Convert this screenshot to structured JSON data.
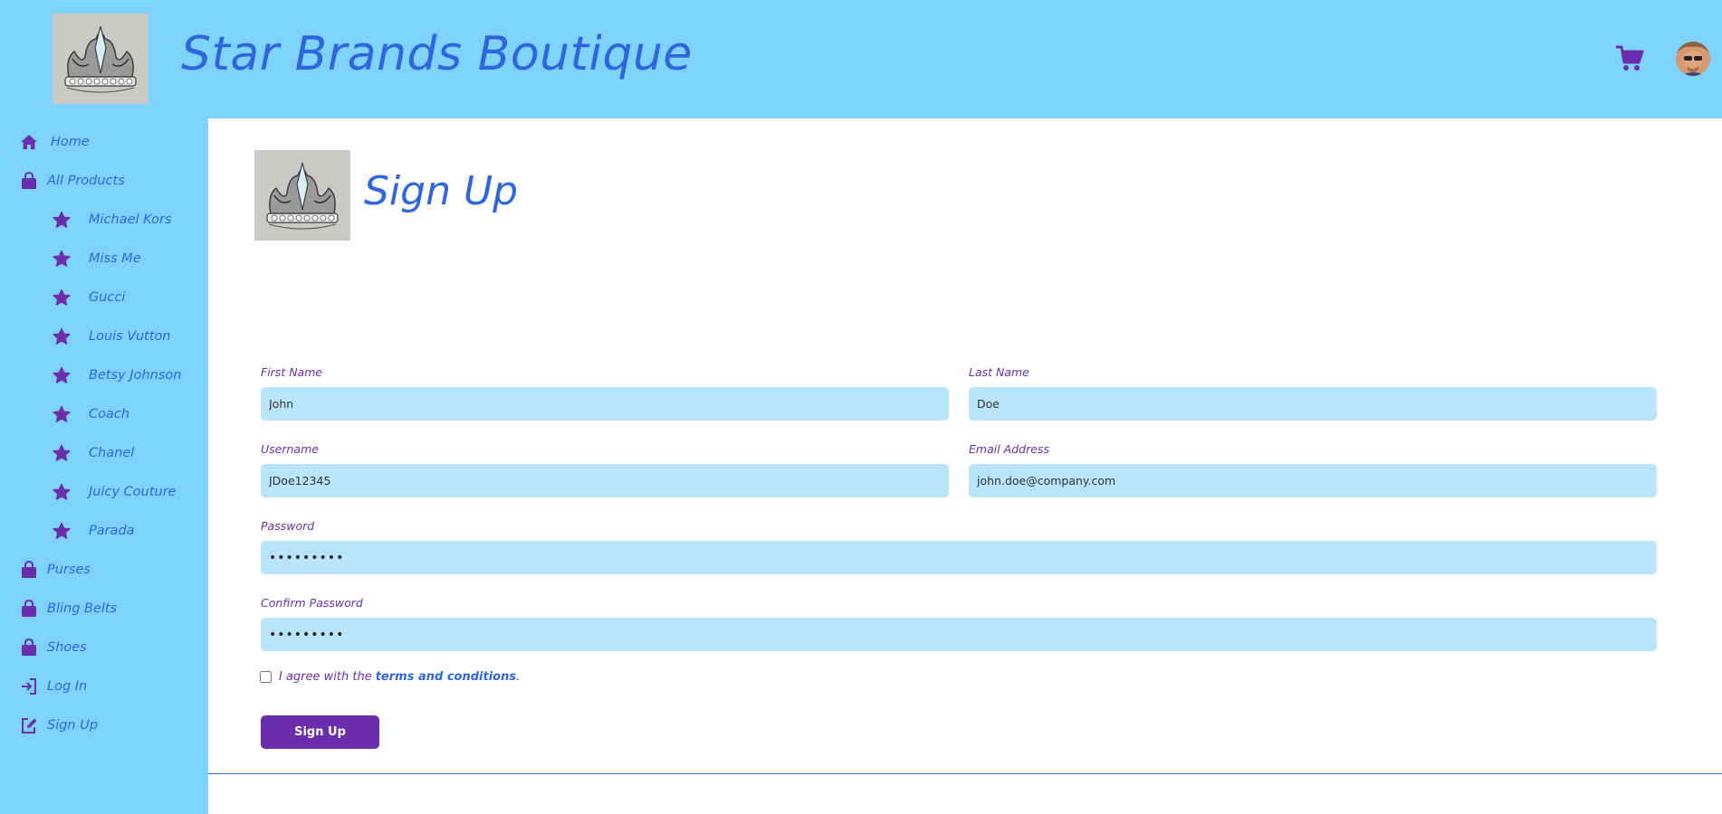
{
  "header": {
    "title": "Star Brands Boutique",
    "logo_icon": "crown-icon",
    "cart_icon": "cart-icon",
    "avatar_icon": "user-avatar"
  },
  "sidebar": {
    "items": [
      {
        "label": "Home",
        "icon": "home-icon"
      },
      {
        "label": "All Products",
        "icon": "shopping-bag-icon"
      },
      {
        "label": "Michael Kors",
        "icon": "star-icon"
      },
      {
        "label": "Miss Me",
        "icon": "star-icon"
      },
      {
        "label": "Gucci",
        "icon": "star-icon"
      },
      {
        "label": "Louis Vutton",
        "icon": "star-icon"
      },
      {
        "label": "Betsy Johnson",
        "icon": "star-icon"
      },
      {
        "label": "Coach",
        "icon": "star-icon"
      },
      {
        "label": "Chanel",
        "icon": "star-icon"
      },
      {
        "label": "Juicy Couture",
        "icon": "star-icon"
      },
      {
        "label": "Parada",
        "icon": "star-icon"
      },
      {
        "label": "Purses",
        "icon": "shopping-bag-icon"
      },
      {
        "label": "Bling Belts",
        "icon": "shopping-bag-icon"
      },
      {
        "label": "Shoes",
        "icon": "shopping-bag-icon"
      },
      {
        "label": "Log In",
        "icon": "login-icon"
      },
      {
        "label": "Sign Up",
        "icon": "edit-icon"
      }
    ]
  },
  "main": {
    "title": "Sign Up",
    "form": {
      "first_name_label": "First Name",
      "first_name_value": "John",
      "last_name_label": "Last Name",
      "last_name_value": "Doe",
      "username_label": "Username",
      "username_value": "JDoe12345",
      "email_label": "Email Address",
      "email_value": "john.doe@company.com",
      "password_label": "Password",
      "password_value": "•••••••••",
      "confirm_label": "Confirm Password",
      "confirm_value": "•••••••••",
      "agree_prefix": "I agree with the",
      "agree_link": "terms and conditions",
      "agree_suffix": ".",
      "agree_checked": false,
      "submit_label": "Sign Up"
    }
  },
  "colors": {
    "background": "#7ed3fb",
    "accent_blue": "#2f66de",
    "accent_purple": "#6b2fae",
    "input_bg": "#b9e5fb"
  }
}
